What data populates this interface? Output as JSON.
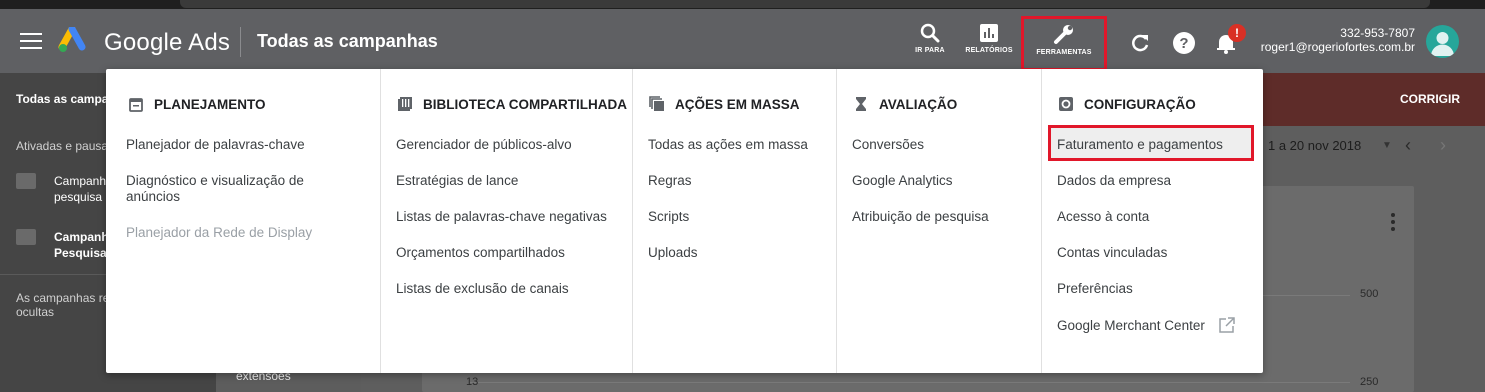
{
  "header": {
    "brand": "Google Ads",
    "page_title": "Todas as campanhas",
    "tools": [
      {
        "label": "IR PARA",
        "icon": "search-icon"
      },
      {
        "label": "RELATÓRIOS",
        "icon": "bar-chart-icon"
      },
      {
        "label": "FERRAMENTAS",
        "icon": "wrench-icon"
      }
    ],
    "notification_badge": "!",
    "account_id": "332-953-7807",
    "account_email": "roger1@rogeriofortes.com.br"
  },
  "background": {
    "alert_text": "Todas as campa",
    "fix_label": "CORRIGIR",
    "sidebar_sub": "Ativadas e pausa",
    "sidebar_items": [
      {
        "line1": "Campanh",
        "line2": "pesquisa"
      },
      {
        "line1": "Campanh",
        "line2": "Pesquisa"
      }
    ],
    "hidden_campaigns_line1": "As campanhas re",
    "hidden_campaigns_line2": "ocultas",
    "mid_text": "extensões",
    "date_range": "1 a 20 nov 2018",
    "y_ticks_right": [
      "500",
      "250"
    ],
    "y_tick_left": "13"
  },
  "menu": {
    "columns": [
      {
        "title": "PLANEJAMENTO",
        "icon": "calendar-icon",
        "items": [
          {
            "label": "Planejador de palavras-chave"
          },
          {
            "label": "Diagnóstico e visualização de anúncios"
          },
          {
            "label": "Planejador da Rede de Display",
            "disabled": true
          }
        ]
      },
      {
        "title": "BIBLIOTECA COMPARTILHADA",
        "icon": "library-icon",
        "items": [
          {
            "label": "Gerenciador de públicos-alvo"
          },
          {
            "label": "Estratégias de lance"
          },
          {
            "label": "Listas de palavras-chave negativas"
          },
          {
            "label": "Orçamentos compartilhados"
          },
          {
            "label": "Listas de exclusão de canais"
          }
        ]
      },
      {
        "title": "AÇÕES EM MASSA",
        "icon": "copy-stack-icon",
        "items": [
          {
            "label": "Todas as ações em massa"
          },
          {
            "label": "Regras"
          },
          {
            "label": "Scripts"
          },
          {
            "label": "Uploads"
          }
        ]
      },
      {
        "title": "AVALIAÇÃO",
        "icon": "hourglass-icon",
        "items": [
          {
            "label": "Conversões"
          },
          {
            "label": "Google Analytics"
          },
          {
            "label": "Atribuição de pesquisa"
          }
        ]
      },
      {
        "title": "CONFIGURAÇÃO",
        "icon": "settings-icon",
        "items": [
          {
            "label": "Faturamento e pagamentos"
          },
          {
            "label": "Dados da empresa"
          },
          {
            "label": "Acesso à conta"
          },
          {
            "label": "Contas vinculadas"
          },
          {
            "label": "Preferências"
          },
          {
            "label": "Google Merchant Center",
            "icon": "external-link-icon"
          }
        ]
      }
    ]
  },
  "colors": {
    "topbar": "#5f6063",
    "highlight_red": "#e1172a",
    "alert_red": "#d93025",
    "avatar": "#26a69a"
  }
}
